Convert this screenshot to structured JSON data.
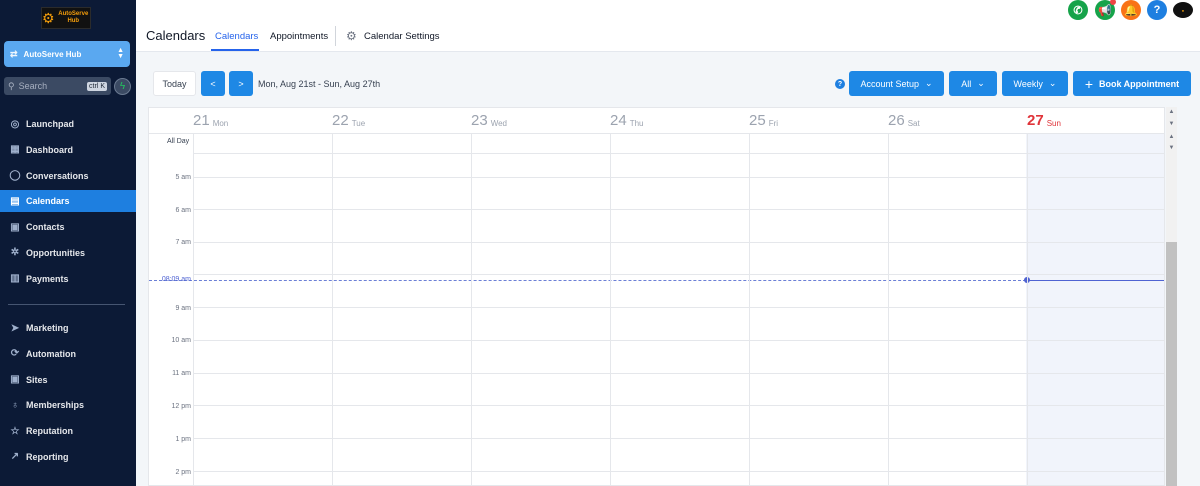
{
  "sidebar": {
    "logo_text": "AutoServe Hub",
    "account_name": "AutoServe Hub",
    "search_placeholder": "Search",
    "search_shortcut": "ctrl K",
    "items_top": [
      {
        "label": "Launchpad",
        "icon": "rocket-icon"
      },
      {
        "label": "Dashboard",
        "icon": "grid-icon"
      },
      {
        "label": "Conversations",
        "icon": "chat-icon"
      },
      {
        "label": "Calendars",
        "icon": "calendar-icon",
        "active": true
      },
      {
        "label": "Contacts",
        "icon": "contacts-icon"
      },
      {
        "label": "Opportunities",
        "icon": "opportunities-icon"
      },
      {
        "label": "Payments",
        "icon": "payments-icon"
      }
    ],
    "items_bottom": [
      {
        "label": "Marketing",
        "icon": "send-icon"
      },
      {
        "label": "Automation",
        "icon": "automation-icon"
      },
      {
        "label": "Sites",
        "icon": "sites-icon"
      },
      {
        "label": "Memberships",
        "icon": "memberships-icon"
      },
      {
        "label": "Reputation",
        "icon": "star-icon"
      },
      {
        "label": "Reporting",
        "icon": "trend-icon"
      }
    ]
  },
  "header": {
    "title": "Calendars",
    "tabs": [
      {
        "label": "Calendars",
        "active": true
      },
      {
        "label": "Appointments"
      },
      {
        "label": "Calendar Settings"
      }
    ],
    "colors": {
      "phone": "#16a34a",
      "announce": "#16a34a",
      "bell": "#f97316",
      "help": "#1e7fe0"
    }
  },
  "toolbar": {
    "today_label": "Today",
    "prev_label": "<",
    "next_label": ">",
    "date_range": "Mon, Aug 21st - Sun, Aug 27th",
    "help_label": "?",
    "account_setup_label": "Account Setup",
    "filter_label": "All",
    "view_label": "Weekly",
    "book_label": "Book Appointment"
  },
  "calendar": {
    "days": [
      {
        "num": "21",
        "name": "Mon"
      },
      {
        "num": "22",
        "name": "Tue"
      },
      {
        "num": "23",
        "name": "Wed"
      },
      {
        "num": "24",
        "name": "Thu"
      },
      {
        "num": "25",
        "name": "Fri"
      },
      {
        "num": "26",
        "name": "Sat"
      },
      {
        "num": "27",
        "name": "Sun",
        "today": true
      }
    ],
    "all_day_label": "All Day",
    "time_labels": [
      "5 am",
      "6 am",
      "7 am",
      "9 am",
      "10 am",
      "11 am",
      "12 pm",
      "1 pm",
      "2 pm"
    ],
    "current_time": "08:09 am",
    "today_color": "#e0343a",
    "now_line_color": "#4f63d2"
  }
}
